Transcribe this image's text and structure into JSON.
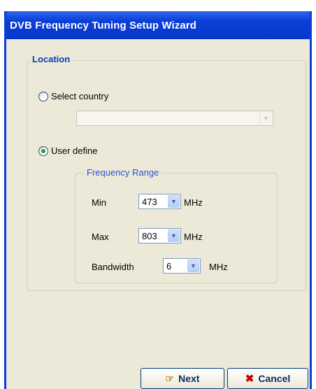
{
  "window": {
    "title": "DVB Frequency Tuning Setup Wizard"
  },
  "location": {
    "legend": "Location",
    "select_country": {
      "label": "Select country",
      "selected": false,
      "value": ""
    },
    "user_define": {
      "label": "User define",
      "selected": true
    }
  },
  "frequency_range": {
    "legend": "Frequency Range",
    "min": {
      "label": "Min",
      "value": "473",
      "unit": "MHz"
    },
    "max": {
      "label": "Max",
      "value": "803",
      "unit": "MHz"
    },
    "bandwidth": {
      "label": "Bandwidth",
      "value": "6",
      "unit": "MHz"
    }
  },
  "buttons": {
    "next": {
      "label": "Next",
      "icon": "pointing-hand-icon"
    },
    "cancel": {
      "label": "Cancel",
      "icon": "x-icon"
    }
  },
  "colors": {
    "titlebar": "#0a3fd8",
    "client_bg": "#ece9d8",
    "legend_location": "#0b3cb6",
    "legend_freq": "#2a55d3"
  }
}
